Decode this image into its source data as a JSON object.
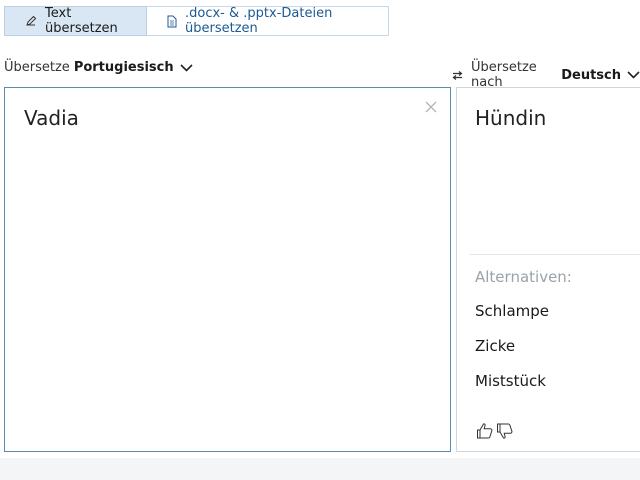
{
  "tabs": [
    {
      "label": "Text übersetzen",
      "active": true
    },
    {
      "label": ".docx- & .pptx-Dateien übersetzen",
      "active": false
    }
  ],
  "source_lang": {
    "prefix": "Übersetze",
    "name": "Portugiesisch"
  },
  "target_lang": {
    "prefix": "Übersetze nach",
    "name": "Deutsch"
  },
  "source": {
    "text": "Vadia"
  },
  "target": {
    "text": "Hündin",
    "alternatives_label": "Alternativen:",
    "alternatives": [
      "Schlampe",
      "Zicke",
      "Miststück"
    ]
  },
  "colors": {
    "accent": "#1b5a92",
    "active_tab_bg": "#d9e7f4",
    "panel_border": "#5a8bb0"
  }
}
